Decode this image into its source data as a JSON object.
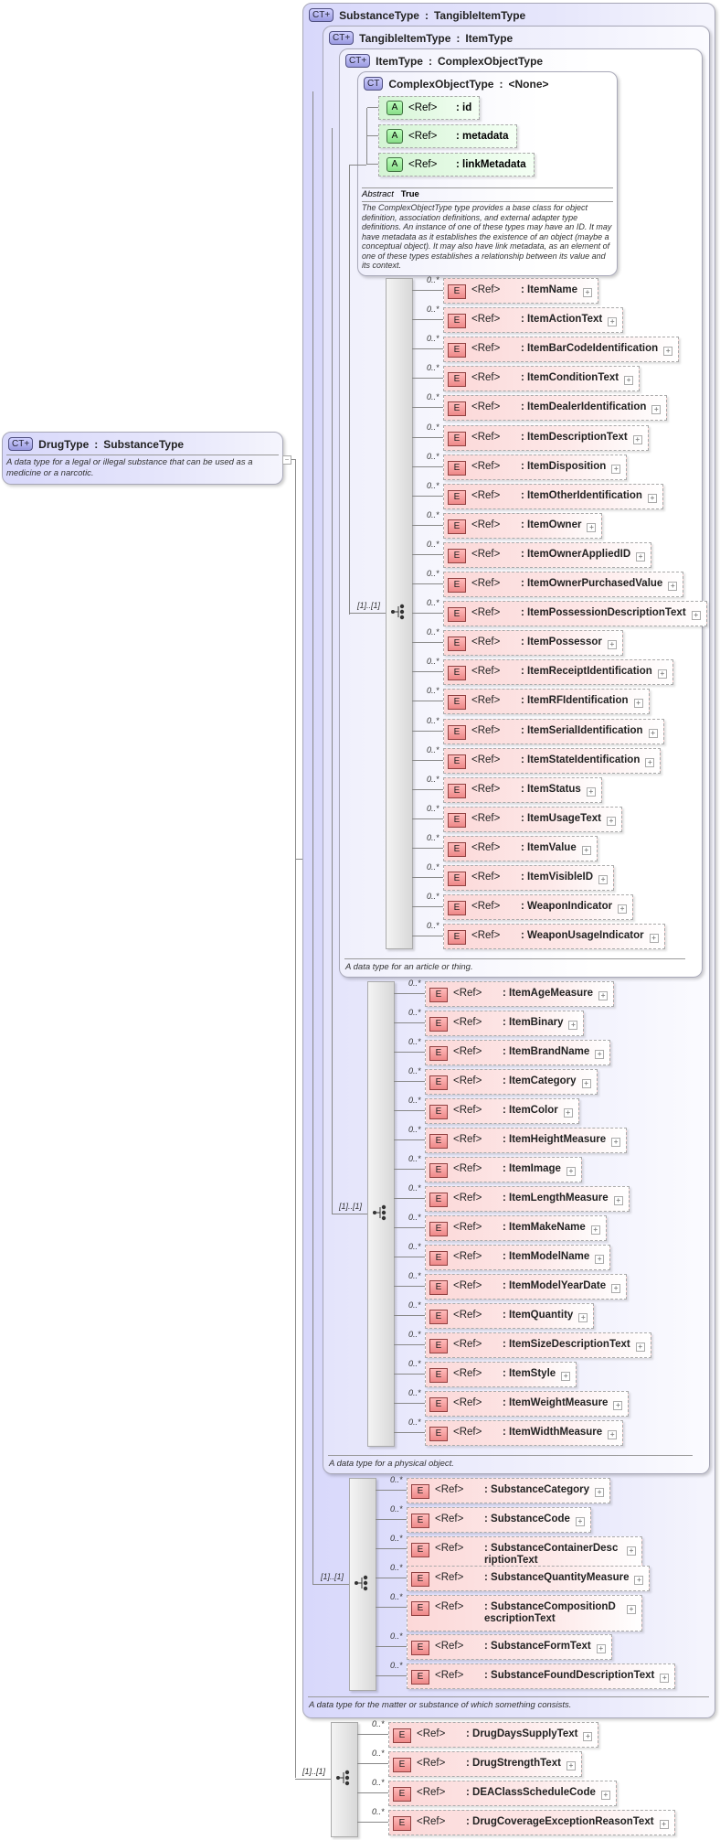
{
  "drug_type": {
    "name": "DrugType",
    "base": "SubstanceType",
    "badge": "CT+",
    "description": "A data type for a legal or illegal substance that can be used as a medicine or a narcotic.",
    "collapse": "−"
  },
  "substance_type": {
    "name": "SubstanceType",
    "base": "TangibleItemType",
    "badge": "CT+",
    "description": "A data type for the matter or substance of which something consists."
  },
  "tangible_item_type": {
    "name": "TangibleItemType",
    "base": "ItemType",
    "badge": "CT+",
    "description": "A data type for a physical object."
  },
  "item_type": {
    "name": "ItemType",
    "base": "ComplexObjectType",
    "badge": "CT+",
    "description": "A data type for an article or thing."
  },
  "complex_object_type": {
    "name": "ComplexObjectType",
    "base": "<None>",
    "badge": "CT",
    "abstract_label": "Abstract",
    "abstract_value": "True",
    "description": "The ComplexObjectType type provides a base class for object definition, association definitions, and external adapter type definitions. An instance of one of these types may have an ID. It may have metadata as it establishes the existence of an object (maybe a conceptual object). It may also have link metadata, as an element of one of these types establishes a relationship between its value and its context.",
    "attributes": [
      {
        "badge": "A",
        "ref": "<Ref>",
        "name": ": id"
      },
      {
        "badge": "A",
        "ref": "<Ref>",
        "name": ": metadata"
      },
      {
        "badge": "A",
        "ref": "<Ref>",
        "name": ": linkMetadata"
      }
    ]
  },
  "labels": {
    "ref": "<Ref>",
    "occurs": "0..*",
    "sequence_occurs": "[1]..[1]",
    "element_badge": "E",
    "expand": "+"
  },
  "groups": {
    "item": [
      "ItemName",
      "ItemActionText",
      "ItemBarCodeIdentification",
      "ItemConditionText",
      "ItemDealerIdentification",
      "ItemDescriptionText",
      "ItemDisposition",
      "ItemOtherIdentification",
      "ItemOwner",
      "ItemOwnerAppliedID",
      "ItemOwnerPurchasedValue",
      "ItemPossessionDescriptionText",
      "ItemPossessor",
      "ItemReceiptIdentification",
      "ItemRFIdentification",
      "ItemSerialIdentification",
      "ItemStateIdentification",
      "ItemStatus",
      "ItemUsageText",
      "ItemValue",
      "ItemVisibleID",
      "WeaponIndicator",
      "WeaponUsageIndicator"
    ],
    "tangible": [
      "ItemAgeMeasure",
      "ItemBinary",
      "ItemBrandName",
      "ItemCategory",
      "ItemColor",
      "ItemHeightMeasure",
      "ItemImage",
      "ItemLengthMeasure",
      "ItemMakeName",
      "ItemModelName",
      "ItemModelYearDate",
      "ItemQuantity",
      "ItemSizeDescriptionText",
      "ItemStyle",
      "ItemWeightMeasure",
      "ItemWidthMeasure"
    ],
    "substance": [
      "SubstanceCategory",
      "SubstanceCode",
      "SubstanceContainerDescriptionText",
      "SubstanceQuantityMeasure",
      "SubstanceCompositionDescriptionText",
      "SubstanceFormText",
      "SubstanceFoundDescriptionText"
    ],
    "drug": [
      "DrugDaysSupplyText",
      "DrugStrengthText",
      "DEAClassScheduleCode",
      "DrugCoverageExceptionReasonText"
    ]
  }
}
